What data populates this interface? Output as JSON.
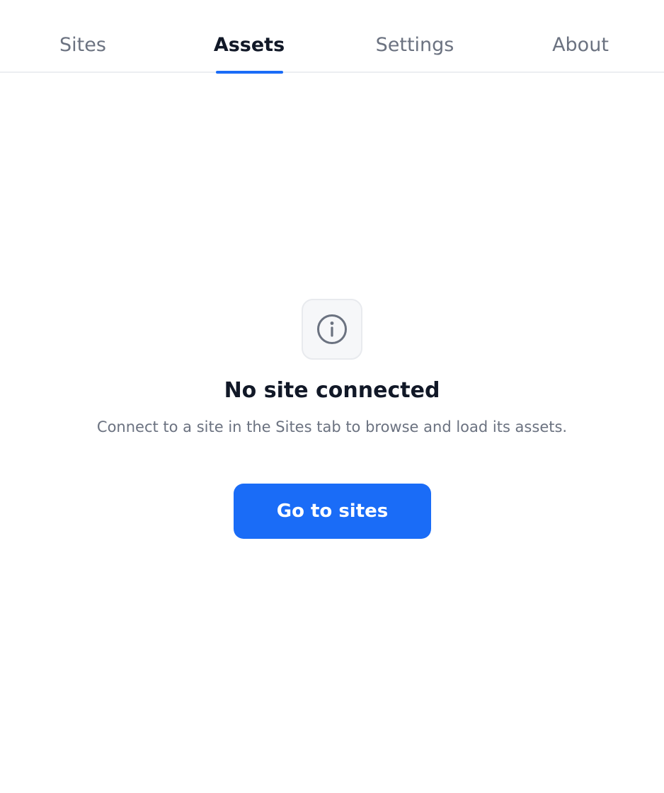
{
  "tabs": [
    {
      "label": "Sites",
      "active": false
    },
    {
      "label": "Assets",
      "active": true
    },
    {
      "label": "Settings",
      "active": false
    },
    {
      "label": "About",
      "active": false
    }
  ],
  "empty_state": {
    "icon": "info-icon",
    "title": "No site connected",
    "message": "Connect to a site in the Sites tab to browse and load its assets.",
    "button_label": "Go to sites"
  },
  "colors": {
    "accent": "#1a6cf7",
    "text_primary": "#111827",
    "text_muted": "#6b7280",
    "icon_stroke": "#6b7280",
    "divider": "#eceef2"
  }
}
